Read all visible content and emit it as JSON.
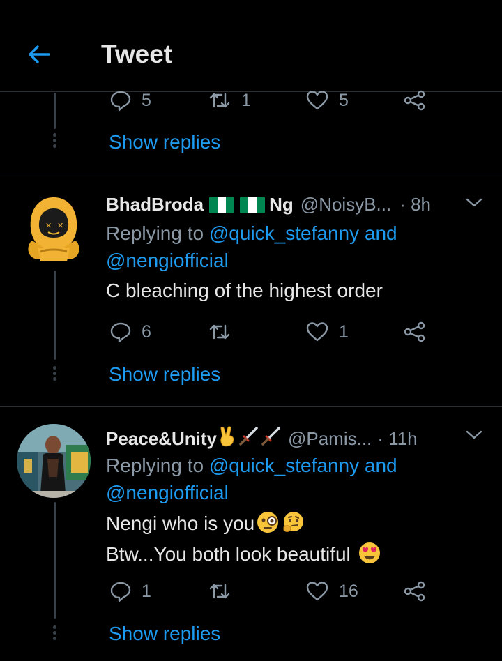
{
  "header": {
    "title": "Tweet"
  },
  "top_actions": {
    "reply_count": "5",
    "retweet_count": "1",
    "like_count": "5"
  },
  "show_replies": "Show replies",
  "tweets": [
    {
      "name": "BhadBroda",
      "name_suffix": "Ng",
      "handle": "@NoisyB...",
      "time": "· 8h",
      "replying_prefix": "Replying to",
      "mention1": "@quick_stefanny",
      "and": "and",
      "mention2": "@nengiofficial",
      "text": "C bleaching of the highest order",
      "reply_count": "6",
      "retweet_count": "",
      "like_count": "1"
    },
    {
      "name": "Peace&Unity",
      "handle": "@Pamis...",
      "time": "· 11h",
      "replying_prefix": "Replying to",
      "mention1": "@quick_stefanny",
      "and": "and",
      "mention2": "@nengiofficial",
      "text_line1": "Nengi who is you",
      "text_line2": "Btw...You both look beautiful",
      "reply_count": "1",
      "retweet_count": "",
      "like_count": "16"
    }
  ],
  "colors": {
    "accent": "#1d9bf0",
    "muted": "#8b98a5",
    "background": "#000000",
    "flag_green": "#008751"
  }
}
